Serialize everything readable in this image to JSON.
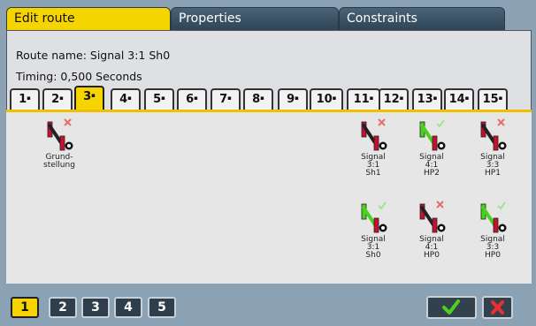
{
  "tabs": {
    "edit_route": "Edit route",
    "properties": "Properties",
    "constraints": "Constraints"
  },
  "info": {
    "route_name": "Route name: Signal 3:1 Sh0",
    "timing": "Timing: 0,500 Seconds"
  },
  "number_tabs": [
    "1",
    "2",
    "3",
    "4",
    "5",
    "6",
    "7",
    "8",
    "9",
    "10",
    "11",
    "12",
    "13",
    "14",
    "15"
  ],
  "active_number_tab": "3",
  "signals": [
    {
      "label": "Grund-\nstellung",
      "state": "off"
    },
    {
      "label": "Signal\n3:1\nSh1",
      "state": "off"
    },
    {
      "label": "Signal\n4:1\nHP2",
      "state": "on"
    },
    {
      "label": "Signal\n3:3\nHP1",
      "state": "off"
    },
    {
      "label": "Signal\n3:1\nSh0",
      "state": "on"
    },
    {
      "label": "Signal\n4:1\nHP0",
      "state": "off"
    },
    {
      "label": "Signal\n3:3\nHP0",
      "state": "on"
    }
  ],
  "pages": [
    "1",
    "2",
    "3",
    "4",
    "5"
  ],
  "active_page": "1",
  "colors": {
    "accent": "#f5d400",
    "ok": "#4cd020",
    "cancel": "#e83030"
  }
}
